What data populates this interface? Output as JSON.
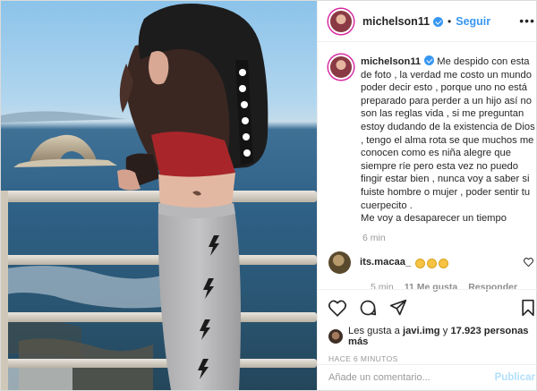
{
  "header": {
    "username": "michelson11",
    "dot": "•",
    "follow_label": "Seguir",
    "more_icon": "more-options-icon"
  },
  "post": {
    "username": "michelson11",
    "caption": "Me despido con esta de foto , la verdad me costo un mundo poder decir esto , porque uno no está preparado para perder a un hijo así no son las reglas vida , si me preguntan estoy dudando de la existencia de Dios , tengo el alma rota se que muchos me conocen como es niña alegre que siempre ríe pero esta vez no puedo fingir estar bien , nunca voy a saber si fuiste hombre o mujer , poder sentir tu cuerpecito .\nMe voy a desaparecer un tiempo",
    "time": "6 min"
  },
  "comment": {
    "username": "its.macaa_",
    "emojis": [
      "crying-emoji",
      "crying-emoji",
      "crying-emoji"
    ],
    "time": "5 min",
    "likes": "11 Me gusta",
    "reply_label": "Responder"
  },
  "actions": {
    "icons": [
      "heart-icon",
      "comment-icon",
      "share-icon",
      "bookmark-icon"
    ]
  },
  "likes": {
    "prefix": "Les gusta a",
    "user": "javi.img",
    "connector": "y",
    "count": "17.923 personas más"
  },
  "timestamp": "HACE 6 MINUTOS",
  "add_comment": {
    "placeholder": "Añade un comentario...",
    "publish_label": "Publicar"
  },
  "colors": {
    "accent": "#3897f0",
    "publish_disabled": "#b2dffc",
    "text": "#262626",
    "muted": "#999999"
  }
}
